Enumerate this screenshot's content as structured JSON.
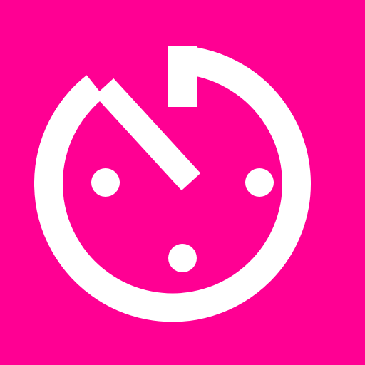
{
  "icon": {
    "name": "timer-clock-icon",
    "background_color": "#ff0093",
    "foreground_color": "#ffffff"
  }
}
